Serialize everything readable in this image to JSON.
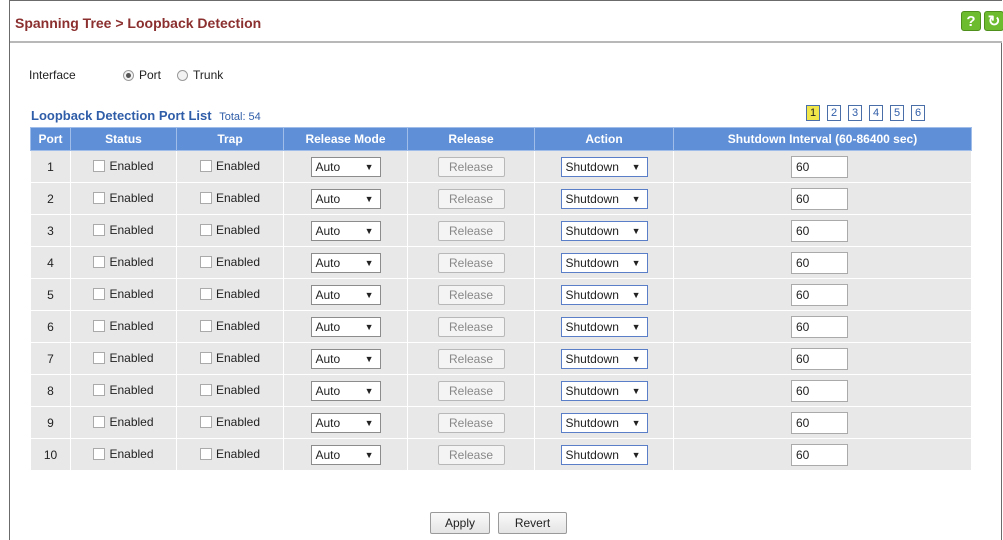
{
  "header": {
    "title": "Spanning Tree > Loopback Detection",
    "help_icon": "help-icon",
    "refresh_icon": "refresh-icon",
    "help_label": "?",
    "refresh_label": "↻",
    "accent_color": "#6dbb2e"
  },
  "interface": {
    "label": "Interface",
    "options": [
      "Port",
      "Trunk"
    ],
    "selected": "Port"
  },
  "list": {
    "title": "Loopback Detection Port List",
    "total": "Total: 54",
    "pages": [
      "1",
      "2",
      "3",
      "4",
      "5",
      "6"
    ],
    "current_page": "1"
  },
  "table": {
    "columns": [
      "Port",
      "Status",
      "Trap",
      "Release Mode",
      "Release",
      "Action",
      "Shutdown Interval (60-86400 sec)"
    ],
    "rows": [
      {
        "port": "1",
        "status": "Enabled",
        "trap": "Enabled",
        "release_mode": "Auto",
        "release": "Release",
        "action": "Shutdown",
        "interval": "60"
      },
      {
        "port": "2",
        "status": "Enabled",
        "trap": "Enabled",
        "release_mode": "Auto",
        "release": "Release",
        "action": "Shutdown",
        "interval": "60"
      },
      {
        "port": "3",
        "status": "Enabled",
        "trap": "Enabled",
        "release_mode": "Auto",
        "release": "Release",
        "action": "Shutdown",
        "interval": "60"
      },
      {
        "port": "4",
        "status": "Enabled",
        "trap": "Enabled",
        "release_mode": "Auto",
        "release": "Release",
        "action": "Shutdown",
        "interval": "60"
      },
      {
        "port": "5",
        "status": "Enabled",
        "trap": "Enabled",
        "release_mode": "Auto",
        "release": "Release",
        "action": "Shutdown",
        "interval": "60"
      },
      {
        "port": "6",
        "status": "Enabled",
        "trap": "Enabled",
        "release_mode": "Auto",
        "release": "Release",
        "action": "Shutdown",
        "interval": "60"
      },
      {
        "port": "7",
        "status": "Enabled",
        "trap": "Enabled",
        "release_mode": "Auto",
        "release": "Release",
        "action": "Shutdown",
        "interval": "60"
      },
      {
        "port": "8",
        "status": "Enabled",
        "trap": "Enabled",
        "release_mode": "Auto",
        "release": "Release",
        "action": "Shutdown",
        "interval": "60"
      },
      {
        "port": "9",
        "status": "Enabled",
        "trap": "Enabled",
        "release_mode": "Auto",
        "release": "Release",
        "action": "Shutdown",
        "interval": "60"
      },
      {
        "port": "10",
        "status": "Enabled",
        "trap": "Enabled",
        "release_mode": "Auto",
        "release": "Release",
        "action": "Shutdown",
        "interval": "60"
      }
    ]
  },
  "footer": {
    "apply_label": "Apply",
    "revert_label": "Revert"
  },
  "colors": {
    "title": "#8b2f2f",
    "table_header": "#5f8fd7",
    "link_blue": "#2f5da8",
    "row_bg": "#e8e8e8",
    "active_page": "#f0e64a"
  }
}
